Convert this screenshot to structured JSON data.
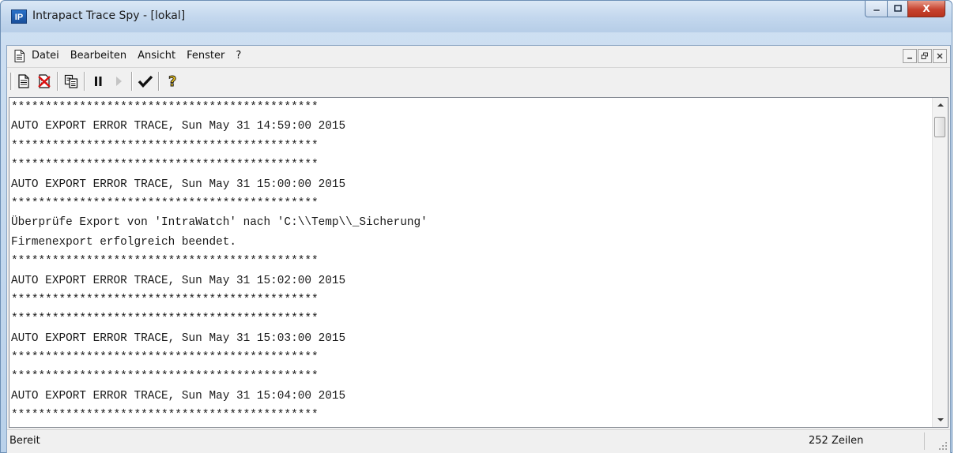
{
  "window": {
    "title": "Intrapact Trace Spy - [lokal]",
    "icon_label": "IP",
    "caption_buttons": {
      "minimize_glyph": "—",
      "maximize_glyph": "☐",
      "close_glyph": "X"
    }
  },
  "menubar": {
    "items": [
      "Datei",
      "Bearbeiten",
      "Ansicht",
      "Fenster",
      "?"
    ],
    "mdi_buttons": {
      "minimize_glyph": "_",
      "restore_glyph": "🗗",
      "close_glyph": "✕"
    }
  },
  "toolbar": {
    "buttons": [
      {
        "name": "new-icon"
      },
      {
        "name": "delete-icon"
      },
      {
        "name": "copy-icon"
      },
      {
        "name": "pause-icon"
      },
      {
        "name": "play-icon"
      },
      {
        "name": "check-icon"
      },
      {
        "name": "help-icon"
      }
    ]
  },
  "trace": {
    "lines": [
      "*********************************************",
      "AUTO EXPORT ERROR TRACE, Sun May 31 14:59:00 2015",
      "*********************************************",
      "*********************************************",
      "AUTO EXPORT ERROR TRACE, Sun May 31 15:00:00 2015",
      "*********************************************",
      "Überprüfe Export von 'IntraWatch' nach 'C:\\\\Temp\\\\_Sicherung'",
      "Firmenexport erfolgreich beendet.",
      "*********************************************",
      "AUTO EXPORT ERROR TRACE, Sun May 31 15:02:00 2015",
      "*********************************************",
      "*********************************************",
      "AUTO EXPORT ERROR TRACE, Sun May 31 15:03:00 2015",
      "*********************************************",
      "*********************************************",
      "AUTO EXPORT ERROR TRACE, Sun May 31 15:04:00 2015",
      "*********************************************"
    ]
  },
  "statusbar": {
    "status": "Bereit",
    "line_count": "252 Zeilen"
  },
  "colors": {
    "titlebar": "#c4d8ee",
    "close_button": "#c7432f",
    "client_bg": "#f0f0f0",
    "trace_bg": "#ffffff"
  }
}
